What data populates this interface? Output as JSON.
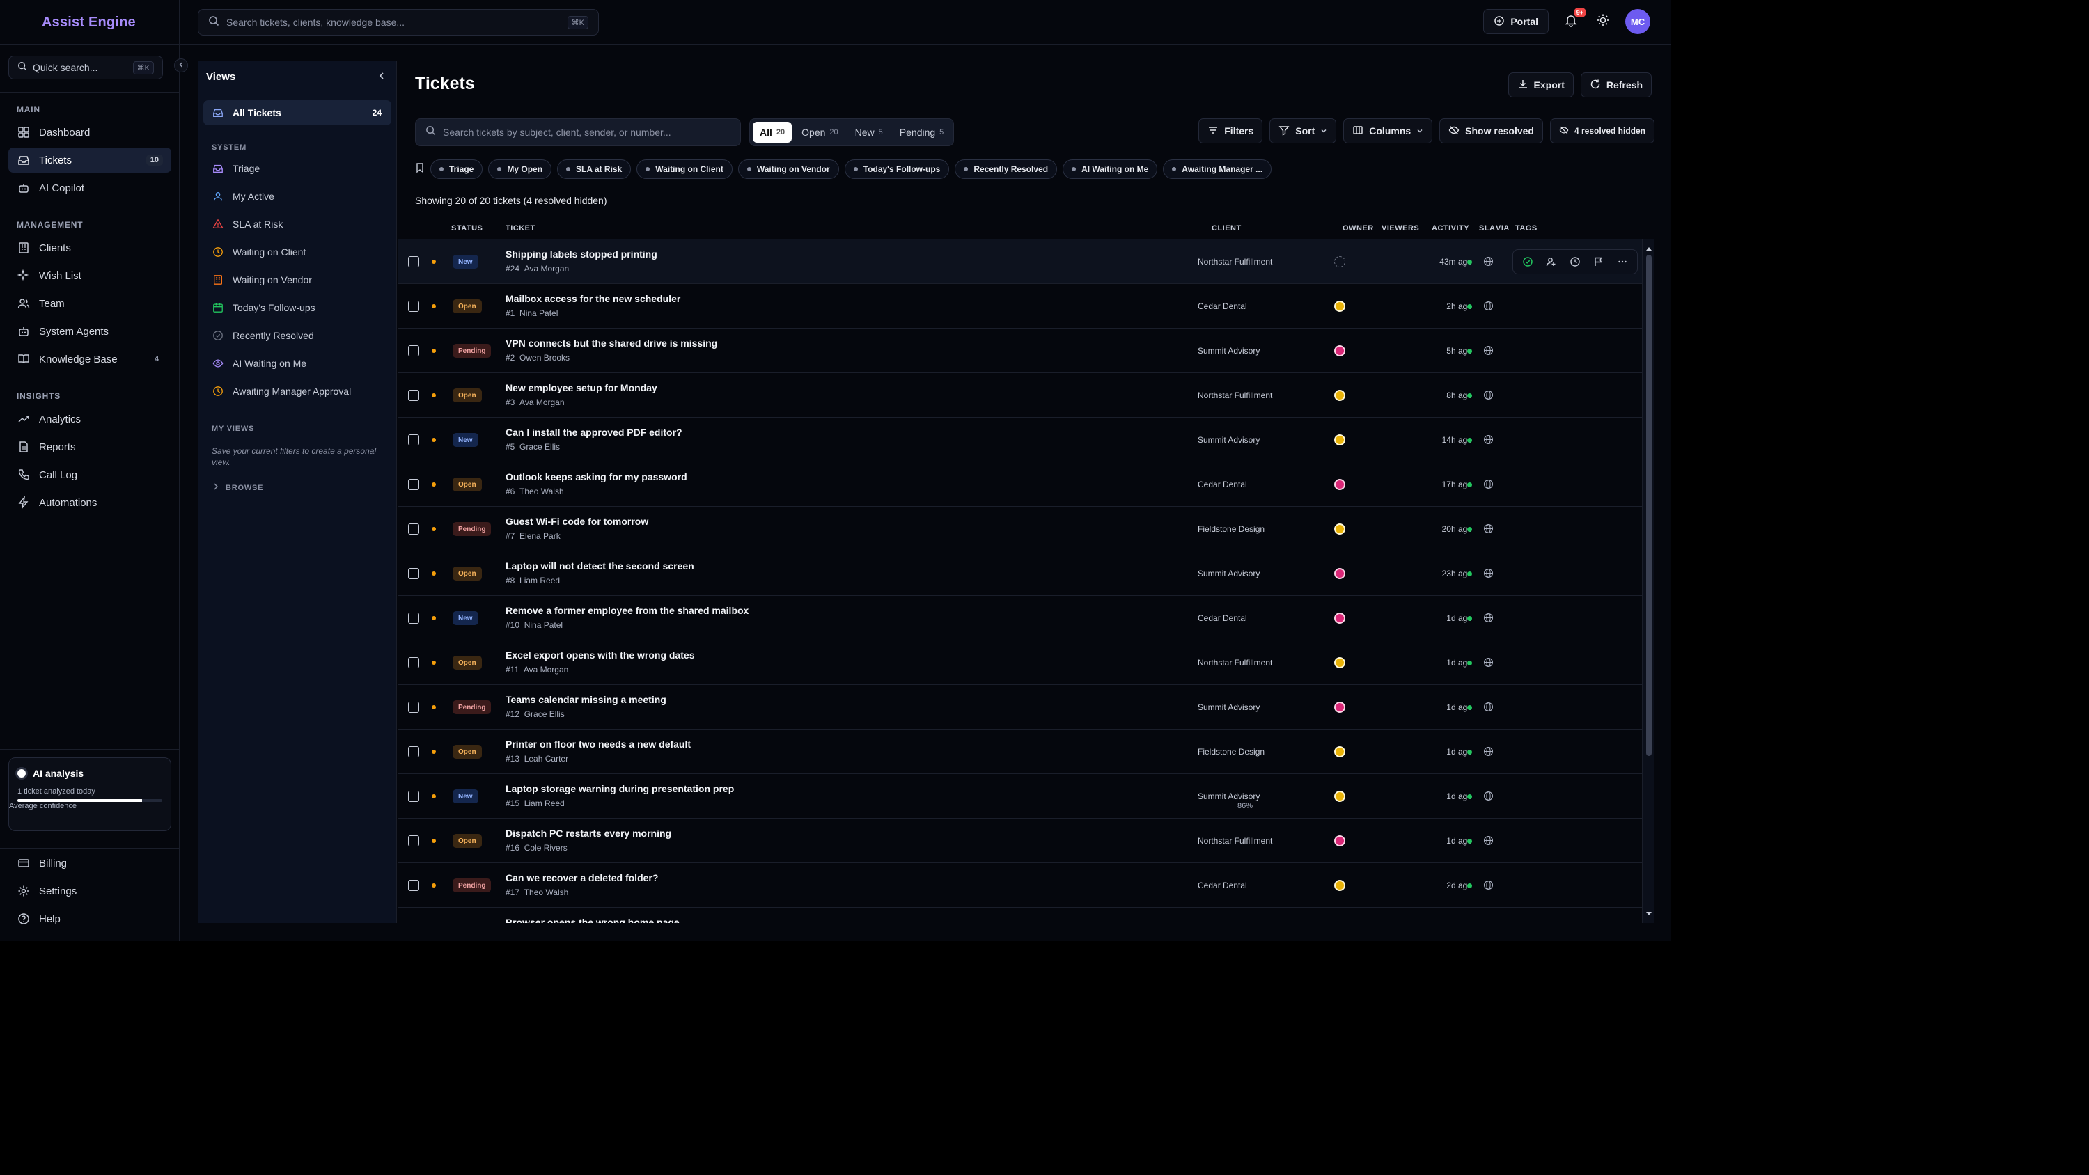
{
  "app": {
    "brand": "Assist Engine",
    "global_search_placeholder": "Search tickets, clients, knowledge base...",
    "global_search_shortcut": "⌘K",
    "portal_label": "Portal",
    "notifications_count": "9+",
    "user_initials": "MC"
  },
  "sidebar": {
    "quick_search_placeholder": "Quick search...",
    "quick_search_shortcut": "⌘K",
    "sections": {
      "main": "MAIN",
      "management": "MANAGEMENT",
      "insights": "INSIGHTS"
    },
    "items": {
      "dashboard": "Dashboard",
      "tickets": "Tickets",
      "tickets_count": "10",
      "ai_copilot": "AI Copilot",
      "clients": "Clients",
      "wish_list": "Wish List",
      "team": "Team",
      "system_agents": "System Agents",
      "knowledge_base": "Knowledge Base",
      "knowledge_base_count": "4",
      "analytics": "Analytics",
      "reports": "Reports",
      "call_log": "Call Log",
      "automations": "Automations",
      "billing": "Billing",
      "settings": "Settings",
      "help": "Help"
    },
    "ai_card": {
      "title": "AI analysis",
      "subtitle": "1 ticket analyzed today",
      "confidence_label": "Average confidence",
      "confidence_value": "86%",
      "confidence_fraction": 0.86
    }
  },
  "views": {
    "title": "Views",
    "all_tickets": "All Tickets",
    "all_tickets_count": "24",
    "system_label": "SYSTEM",
    "system_items": [
      "Triage",
      "My Active",
      "SLA at Risk",
      "Waiting on Client",
      "Waiting on Vendor",
      "Today's Follow-ups",
      "Recently Resolved",
      "AI Waiting on Me",
      "Awaiting Manager Approval"
    ],
    "my_views_label": "MY VIEWS",
    "my_views_hint": "Save your current filters to create a personal view.",
    "browse_label": "BROWSE"
  },
  "main": {
    "title": "Tickets",
    "export_label": "Export",
    "refresh_label": "Refresh",
    "search_placeholder": "Search tickets by subject, client, sender, or number...",
    "status_tabs": [
      {
        "label": "All",
        "count": "20"
      },
      {
        "label": "Open",
        "count": "20"
      },
      {
        "label": "New",
        "count": "5"
      },
      {
        "label": "Pending",
        "count": "5"
      }
    ],
    "filters_label": "Filters",
    "sort_label": "Sort",
    "columns_label": "Columns",
    "show_resolved_label": "Show resolved",
    "resolved_hidden_label": "4 resolved hidden",
    "chips": [
      "Triage",
      "My Open",
      "SLA at Risk",
      "Waiting on Client",
      "Waiting on Vendor",
      "Today's Follow-ups",
      "Recently Resolved",
      "AI Waiting on Me",
      "Awaiting Manager ..."
    ],
    "showing_text": "Showing 20 of 20 tickets (4 resolved hidden)",
    "columns": {
      "status": "STATUS",
      "ticket": "TICKET",
      "client": "CLIENT",
      "owner": "OWNER",
      "viewers": "VIEWERS",
      "activity": "ACTIVITY",
      "sla": "SLA",
      "via": "VIA",
      "tags": "TAGS"
    },
    "tickets": [
      {
        "status": "New",
        "subject": "Shipping labels stopped printing",
        "number": "#24",
        "requester": "Ava Morgan",
        "client": "Northstar Fulfillment",
        "owner": "empty",
        "activity": "43m ago"
      },
      {
        "status": "Open",
        "subject": "Mailbox access for the new scheduler",
        "number": "#1",
        "requester": "Nina Patel",
        "client": "Cedar Dental",
        "owner": "yellow",
        "activity": "2h ago"
      },
      {
        "status": "Pending",
        "subject": "VPN connects but the shared drive is missing",
        "number": "#2",
        "requester": "Owen Brooks",
        "client": "Summit Advisory",
        "owner": "pink",
        "activity": "5h ago"
      },
      {
        "status": "Open",
        "subject": "New employee setup for Monday",
        "number": "#3",
        "requester": "Ava Morgan",
        "client": "Northstar Fulfillment",
        "owner": "yellow",
        "activity": "8h ago"
      },
      {
        "status": "New",
        "subject": "Can I install the approved PDF editor?",
        "number": "#5",
        "requester": "Grace Ellis",
        "client": "Summit Advisory",
        "owner": "yellow",
        "activity": "14h ago"
      },
      {
        "status": "Open",
        "subject": "Outlook keeps asking for my password",
        "number": "#6",
        "requester": "Theo Walsh",
        "client": "Cedar Dental",
        "owner": "pink",
        "activity": "17h ago"
      },
      {
        "status": "Pending",
        "subject": "Guest Wi-Fi code for tomorrow",
        "number": "#7",
        "requester": "Elena Park",
        "client": "Fieldstone Design",
        "owner": "yellow",
        "activity": "20h ago"
      },
      {
        "status": "Open",
        "subject": "Laptop will not detect the second screen",
        "number": "#8",
        "requester": "Liam Reed",
        "client": "Summit Advisory",
        "owner": "pink",
        "activity": "23h ago"
      },
      {
        "status": "New",
        "subject": "Remove a former employee from the shared mailbox",
        "number": "#10",
        "requester": "Nina Patel",
        "client": "Cedar Dental",
        "owner": "pink",
        "activity": "1d ago"
      },
      {
        "status": "Open",
        "subject": "Excel export opens with the wrong dates",
        "number": "#11",
        "requester": "Ava Morgan",
        "client": "Northstar Fulfillment",
        "owner": "yellow",
        "activity": "1d ago"
      },
      {
        "status": "Pending",
        "subject": "Teams calendar missing a meeting",
        "number": "#12",
        "requester": "Grace Ellis",
        "client": "Summit Advisory",
        "owner": "pink",
        "activity": "1d ago"
      },
      {
        "status": "Open",
        "subject": "Printer on floor two needs a new default",
        "number": "#13",
        "requester": "Leah Carter",
        "client": "Fieldstone Design",
        "owner": "yellow",
        "activity": "1d ago"
      },
      {
        "status": "New",
        "subject": "Laptop storage warning during presentation prep",
        "number": "#15",
        "requester": "Liam Reed",
        "client": "Summit Advisory",
        "owner": "yellow",
        "activity": "1d ago"
      },
      {
        "status": "Open",
        "subject": "Dispatch PC restarts every morning",
        "number": "#16",
        "requester": "Cole Rivers",
        "client": "Northstar Fulfillment",
        "owner": "pink",
        "activity": "1d ago"
      },
      {
        "status": "Pending",
        "subject": "Can we recover a deleted folder?",
        "number": "#17",
        "requester": "Theo Walsh",
        "client": "Cedar Dental",
        "owner": "yellow",
        "activity": "2d ago"
      },
      {
        "status": "",
        "subject": "Browser opens the wrong home page",
        "number": "",
        "requester": "",
        "client": "",
        "owner": "",
        "activity": ""
      }
    ]
  },
  "colors": {
    "brand": "#a78bfa",
    "accent_avatar": "#6d5bf0",
    "priority_dot": "#f59e0b",
    "sla_ok": "#22c55e"
  }
}
